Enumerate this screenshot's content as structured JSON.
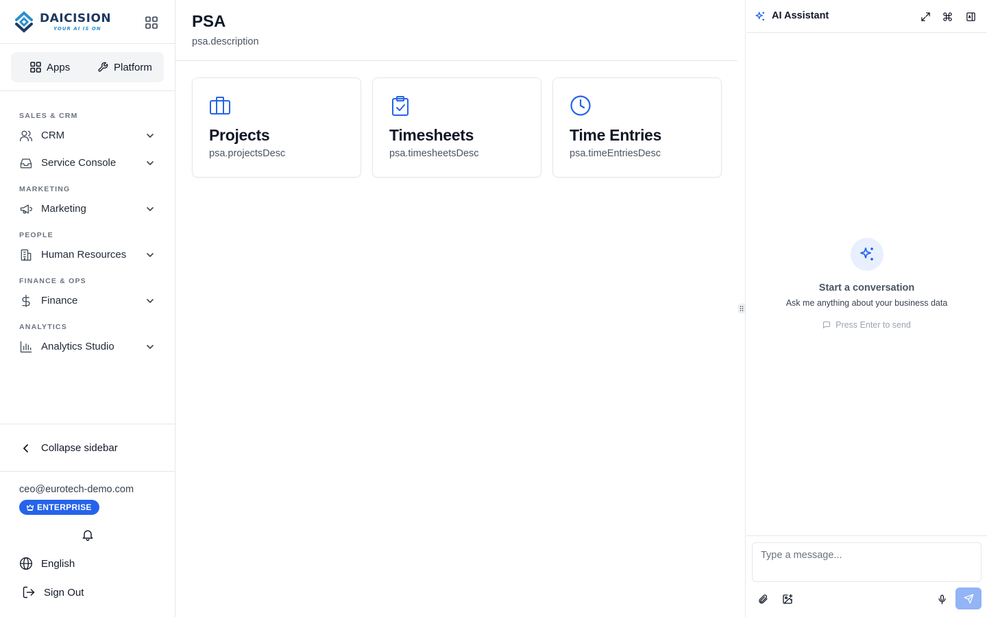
{
  "brand": {
    "name": "DAICISION",
    "tagline": "YOUR AI IS ON"
  },
  "switcher": {
    "apps_label": "Apps",
    "platform_label": "Platform"
  },
  "nav": {
    "sections": [
      {
        "label": "SALES & CRM",
        "items": [
          {
            "label": "CRM",
            "icon": "users-icon"
          },
          {
            "label": "Service Console",
            "icon": "inbox-icon"
          }
        ]
      },
      {
        "label": "MARKETING",
        "items": [
          {
            "label": "Marketing",
            "icon": "megaphone-icon"
          }
        ]
      },
      {
        "label": "PEOPLE",
        "items": [
          {
            "label": "Human Resources",
            "icon": "building-icon"
          }
        ]
      },
      {
        "label": "FINANCE & OPS",
        "items": [
          {
            "label": "Finance",
            "icon": "dollar-icon"
          }
        ]
      },
      {
        "label": "ANALYTICS",
        "items": [
          {
            "label": "Analytics Studio",
            "icon": "bar-chart-icon"
          }
        ]
      }
    ],
    "collapse_label": "Collapse sidebar"
  },
  "user": {
    "email": "ceo@eurotech-demo.com",
    "plan": "ENTERPRISE",
    "language": "English",
    "signout_label": "Sign Out"
  },
  "page": {
    "title": "PSA",
    "description": "psa.description",
    "cards": [
      {
        "title": "Projects",
        "desc": "psa.projectsDesc",
        "icon": "briefcase-icon"
      },
      {
        "title": "Timesheets",
        "desc": "psa.timesheetsDesc",
        "icon": "clipboard-check-icon"
      },
      {
        "title": "Time Entries",
        "desc": "psa.timeEntriesDesc",
        "icon": "clock-icon"
      }
    ]
  },
  "assistant": {
    "title": "AI Assistant",
    "empty_title": "Start a conversation",
    "empty_subtitle": "Ask me anything about your business data",
    "hint": "Press Enter to send",
    "input_placeholder": "Type a message..."
  },
  "colors": {
    "accent": "#2563eb",
    "send_button": "#93b4f5",
    "border": "#e5e7eb",
    "brand_dark": "#1e3a5f",
    "brand_light": "#2a8fcf"
  }
}
